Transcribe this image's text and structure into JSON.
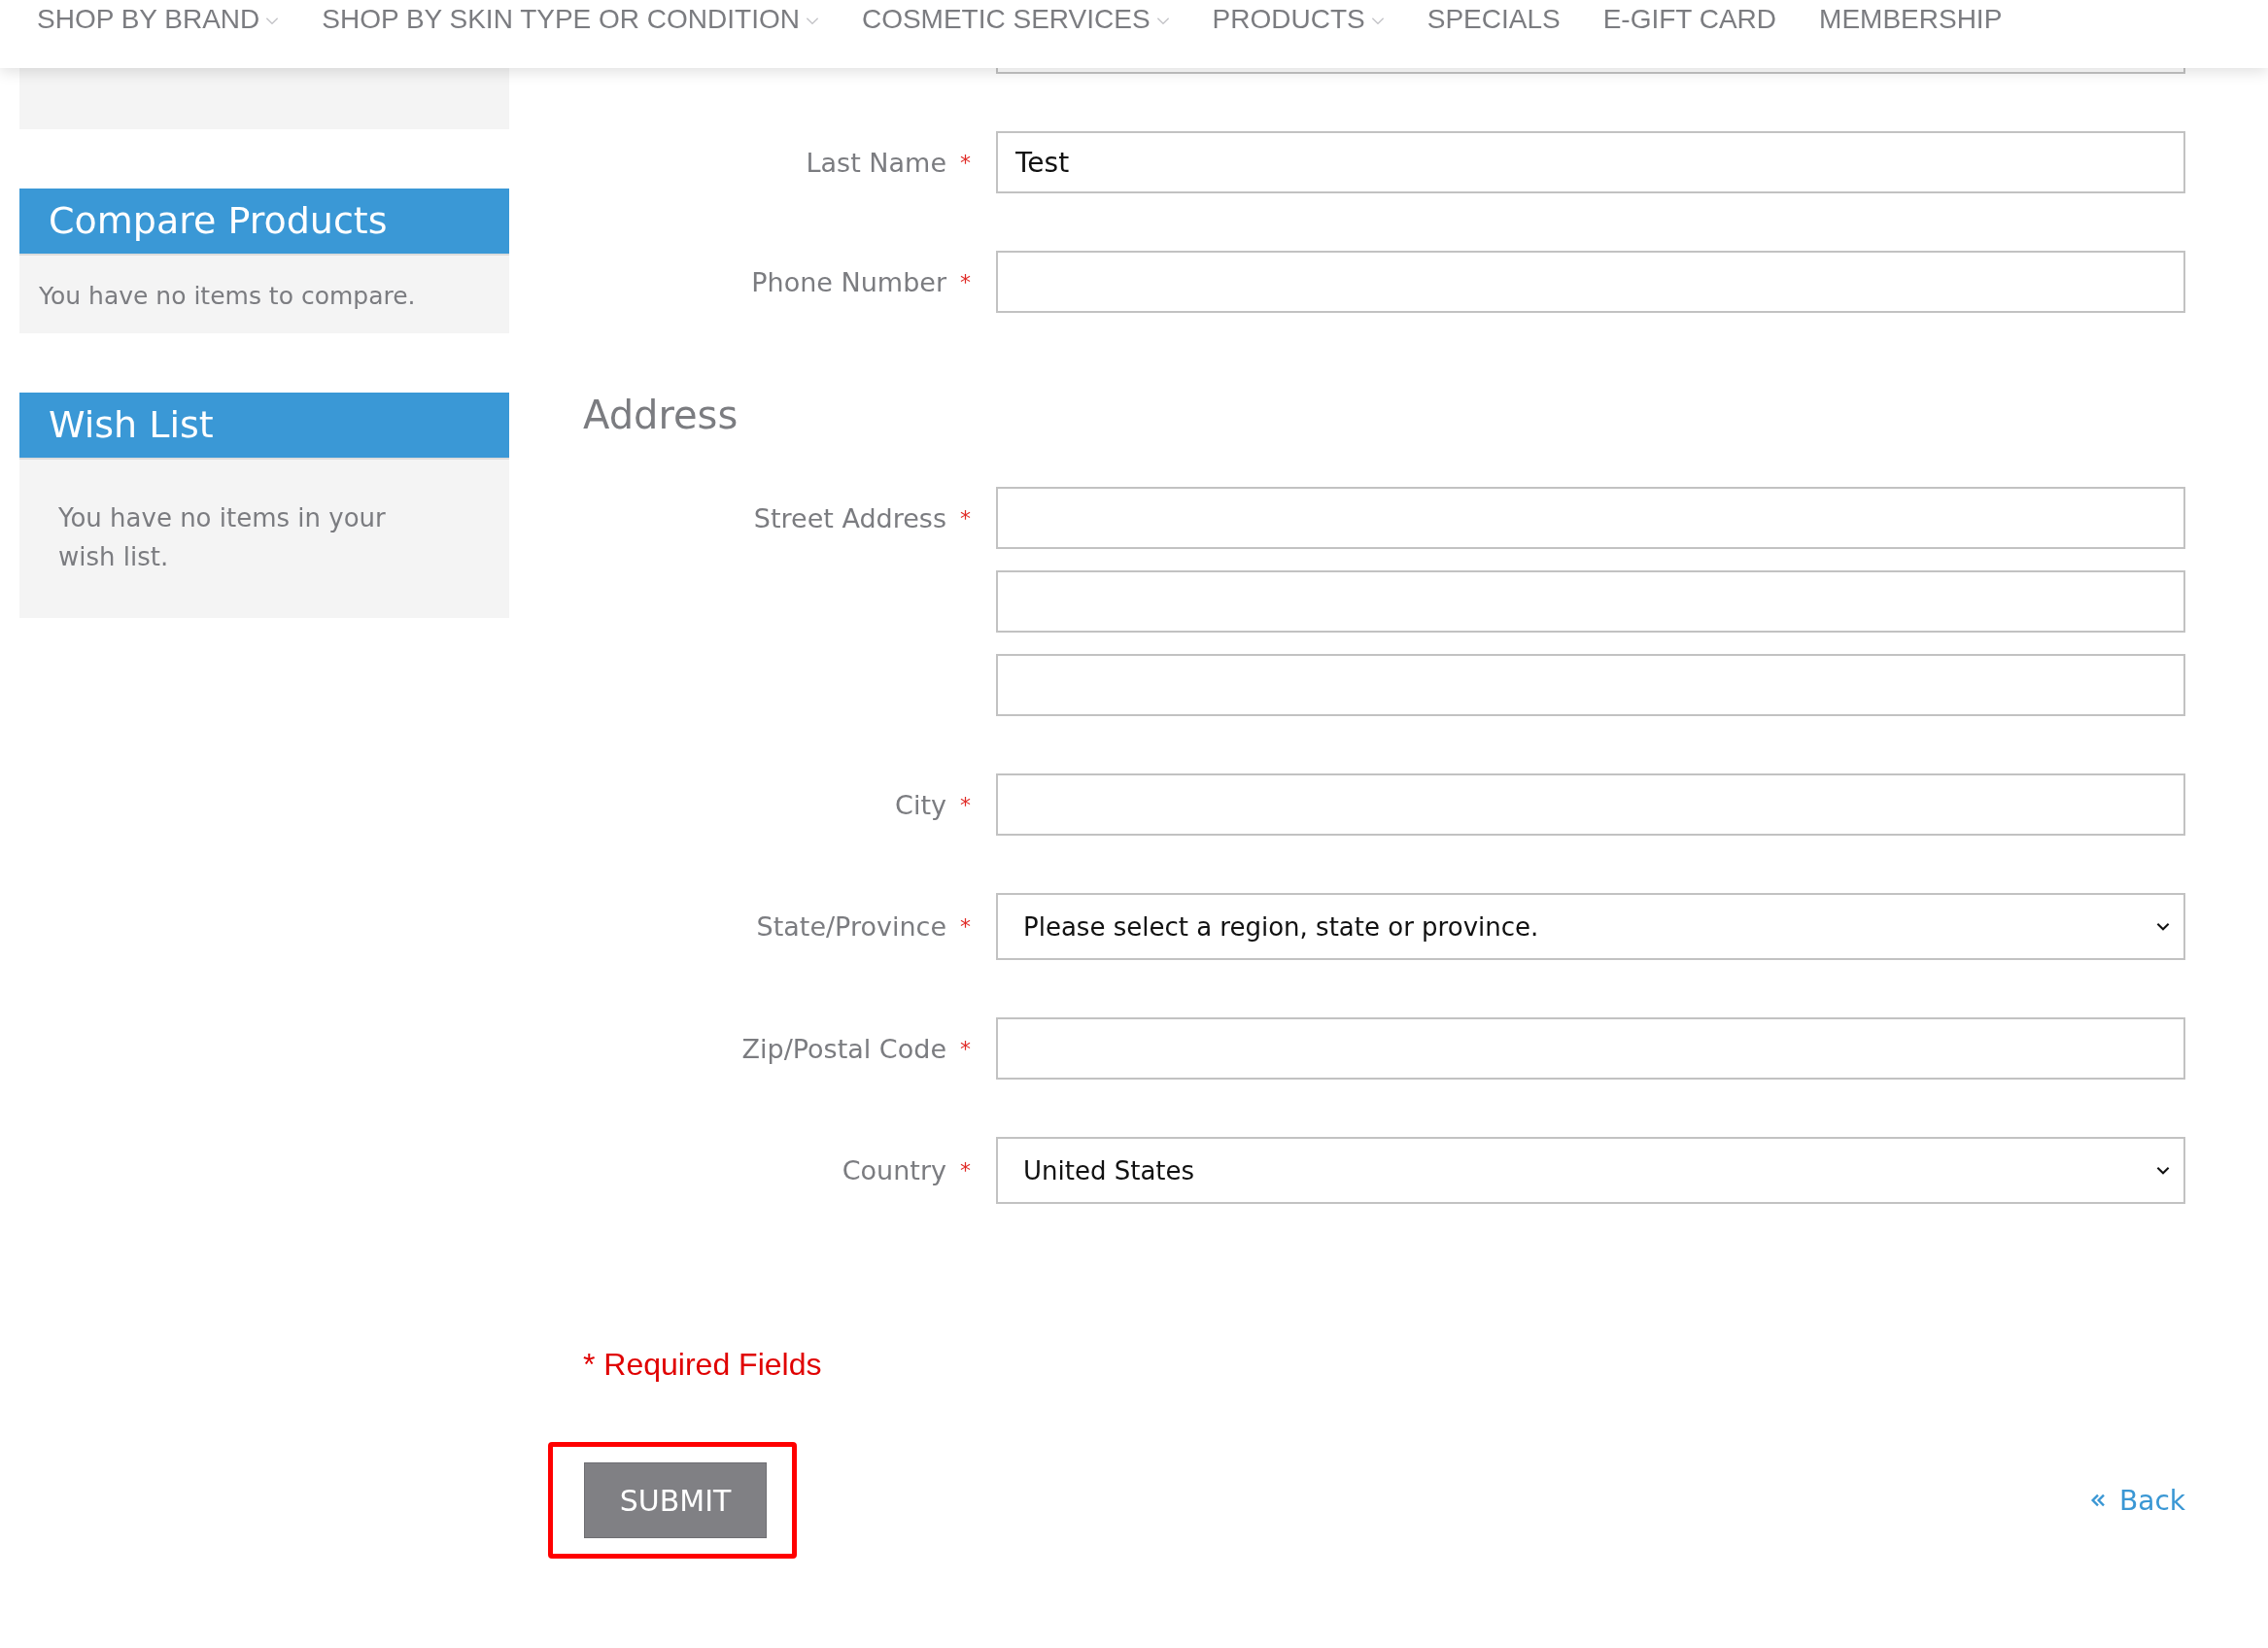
{
  "nav": [
    {
      "label": "SHOP BY BRAND",
      "dropdown": true
    },
    {
      "label": "SHOP BY SKIN TYPE OR CONDITION",
      "dropdown": true
    },
    {
      "label": "COSMETIC SERVICES",
      "dropdown": true
    },
    {
      "label": "PRODUCTS",
      "dropdown": true
    },
    {
      "label": "SPECIALS",
      "dropdown": false
    },
    {
      "label": "E-GIFT CARD",
      "dropdown": false
    },
    {
      "label": "MEMBERSHIP",
      "dropdown": false
    }
  ],
  "sidebar": {
    "blocks": [
      {
        "title": "Compare Products",
        "text": "You have no items to compare.",
        "kind": "compare"
      },
      {
        "title": "Wish List",
        "text": "You have no items in your wish list.",
        "kind": "wishlist"
      }
    ]
  },
  "form": {
    "fields": [
      {
        "kind": "text"
      },
      {
        "kind": "text",
        "label": "Last Name",
        "required_mark": "*",
        "value": "Test"
      },
      {
        "kind": "text",
        "label": "Phone Number",
        "required_mark": "*"
      }
    ],
    "address": {
      "heading": "Address",
      "fields": [
        {
          "kind": "text",
          "label": "Street Address",
          "required_mark": "*"
        },
        {
          "kind": "text"
        },
        {
          "kind": "text"
        },
        {
          "kind": "text",
          "label": "City",
          "required_mark": "*"
        },
        {
          "kind": "select",
          "label": "State/Province",
          "required_mark": "*",
          "value": "Please select a region, state or province."
        },
        {
          "kind": "text",
          "label": "Zip/Postal Code",
          "required_mark": "*"
        },
        {
          "kind": "select",
          "label": "Country",
          "required_mark": "*",
          "value": "United States"
        }
      ]
    },
    "required_note": "* Required Fields",
    "submit": {
      "label": "SUBMIT",
      "highlighted": true
    },
    "back_link": {
      "label": "Back"
    }
  }
}
